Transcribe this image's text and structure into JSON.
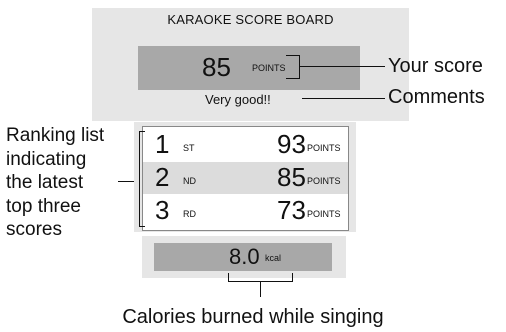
{
  "board": {
    "title": "KARAOKE SCORE BOARD",
    "score": "85",
    "score_unit": "POINTS",
    "comment": "Very good!!"
  },
  "ranking": [
    {
      "rank": "1",
      "suffix": "ST",
      "score": "93",
      "unit": "POINTS",
      "highlighted": false
    },
    {
      "rank": "2",
      "suffix": "ND",
      "score": "85",
      "unit": "POINTS",
      "highlighted": true
    },
    {
      "rank": "3",
      "suffix": "RD",
      "score": "73",
      "unit": "POINTS",
      "highlighted": false
    }
  ],
  "calories": {
    "value": "8.0",
    "unit": "kcal"
  },
  "labels": {
    "your_score": "Your score",
    "comments": "Comments",
    "ranking_lines": [
      "Ranking list",
      "indicating",
      "the latest",
      "top three",
      "scores"
    ],
    "calories": "Calories burned while singing"
  },
  "colors": {
    "panel": "#e6e6e6",
    "dark_bar": "#a8a8a8",
    "highlight_row": "#dcdcdc"
  }
}
